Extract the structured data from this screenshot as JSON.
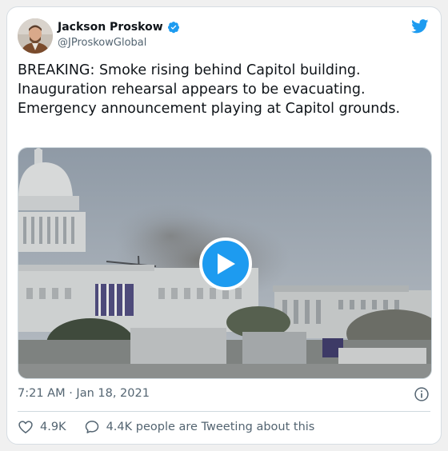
{
  "author": {
    "name": "Jackson Proskow",
    "handle": "@JProskowGlobal",
    "verified": true
  },
  "tweet": {
    "text": "BREAKING: Smoke rising behind Capitol building. Inauguration rehearsal appears to be evacuating. Emergency announcement playing at Capitol grounds.",
    "timestamp": "7:21 AM · Jan 18, 2021"
  },
  "media": {
    "type": "video",
    "play_icon": "play-icon"
  },
  "stats": {
    "likes": "4.9K",
    "discussion": "4.4K people are Tweeting about this"
  },
  "icons": {
    "brand": "twitter-bird-icon",
    "verified": "verified-badge-icon",
    "info": "info-icon",
    "like": "heart-icon",
    "reply": "speech-bubble-icon"
  },
  "colors": {
    "accent": "#1d9bf0",
    "secondary_text": "#536471",
    "primary_text": "#0f1419"
  }
}
